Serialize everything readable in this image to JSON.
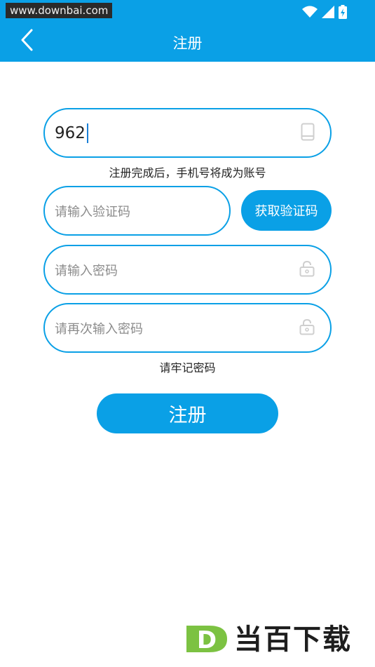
{
  "status_bar": {
    "watermark": "www.downbai.com",
    "icons": [
      "wifi-icon",
      "signal-icon",
      "battery-charging-icon"
    ]
  },
  "header": {
    "back_icon": "back-chevron-icon",
    "title": "注册"
  },
  "form": {
    "phone": {
      "value": "962",
      "icon": "phone-icon"
    },
    "phone_hint": "注册完成后，手机号将成为账号",
    "code": {
      "placeholder": "请输入验证码"
    },
    "get_code_button": "获取验证码",
    "password": {
      "placeholder": "请输入密码",
      "icon": "lock-icon"
    },
    "confirm_password": {
      "placeholder": "请再次输入密码",
      "icon": "lock-icon"
    },
    "password_hint": "请牢记密码",
    "submit_button": "注册"
  },
  "branding": {
    "text": "当百下载",
    "logo_letter": "D"
  },
  "colors": {
    "accent": "#0aa0e6",
    "logo_green": "#7cc242"
  }
}
